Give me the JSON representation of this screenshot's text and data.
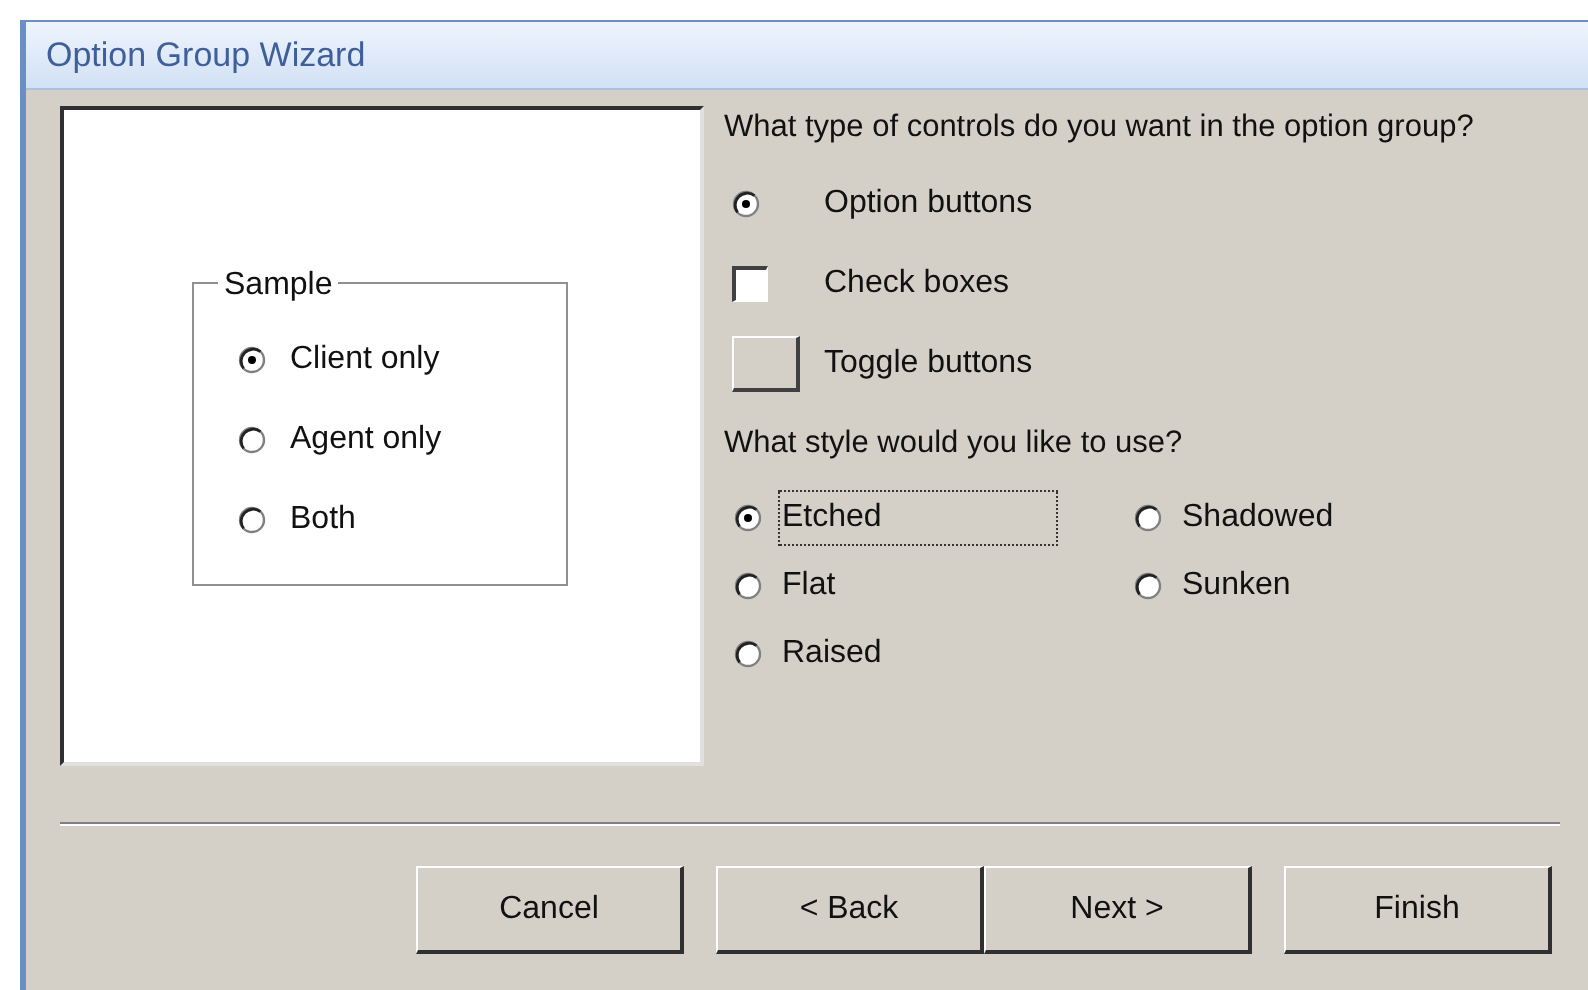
{
  "window": {
    "title": "Option Group Wizard"
  },
  "preview": {
    "group_label": "Sample",
    "options": [
      {
        "label": "Client only",
        "selected": true
      },
      {
        "label": "Agent only",
        "selected": false
      },
      {
        "label": "Both",
        "selected": false
      }
    ]
  },
  "control_type": {
    "question": "What type of controls do you want in the option group?",
    "options": [
      {
        "kind": "radio",
        "label": "Option buttons",
        "selected": true
      },
      {
        "kind": "checkbox",
        "label": "Check boxes",
        "selected": false
      },
      {
        "kind": "toggle",
        "label": "Toggle buttons",
        "selected": false
      }
    ]
  },
  "style": {
    "question": "What style would you like to use?",
    "options": [
      {
        "label": "Etched",
        "selected": true,
        "focused": true
      },
      {
        "label": "Shadowed",
        "selected": false,
        "focused": false
      },
      {
        "label": "Flat",
        "selected": false,
        "focused": false
      },
      {
        "label": "Sunken",
        "selected": false,
        "focused": false
      },
      {
        "label": "Raised",
        "selected": false,
        "focused": false
      }
    ]
  },
  "buttons": [
    "Cancel",
    "< Back",
    "Next >",
    "Finish"
  ]
}
